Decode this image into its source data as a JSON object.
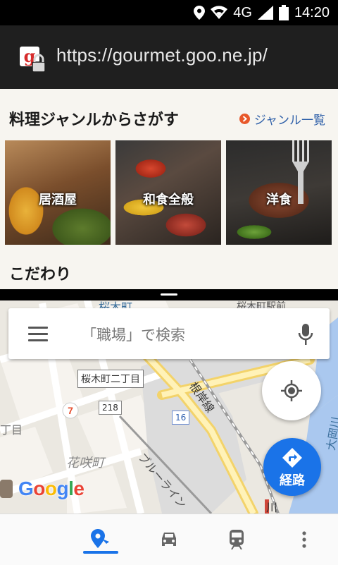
{
  "status_bar": {
    "network": "4G",
    "time": "14:20"
  },
  "browser": {
    "url": "https://gourmet.goo.ne.jp/"
  },
  "gourmet": {
    "section_title": "料理ジャンルからさがす",
    "genre_link": "ジャンル一覧",
    "cards": [
      {
        "label": "居酒屋"
      },
      {
        "label": "和食全般"
      },
      {
        "label": "洋食"
      }
    ],
    "section2_title": "こだわり"
  },
  "map": {
    "search_placeholder": "「職場」で検索",
    "route_label": "経路",
    "logo": "Google",
    "labels": {
      "sakuragicho_nichome": "桜木町二丁目",
      "negishi_line": "根岸線",
      "hanasakicho": "花咲町",
      "blue_line": "ブルーライン",
      "route_218": "218",
      "route_16": "16",
      "sakuragicho_station": "桜木町駅前",
      "sakuragi_top": "桜木町",
      "chome_left": "丁目",
      "oooka_river": "大岡川",
      "kawa": "川"
    }
  },
  "colors": {
    "accent": "#1a73e8",
    "link": "#2e5fa8",
    "orange": "#e8582a"
  }
}
